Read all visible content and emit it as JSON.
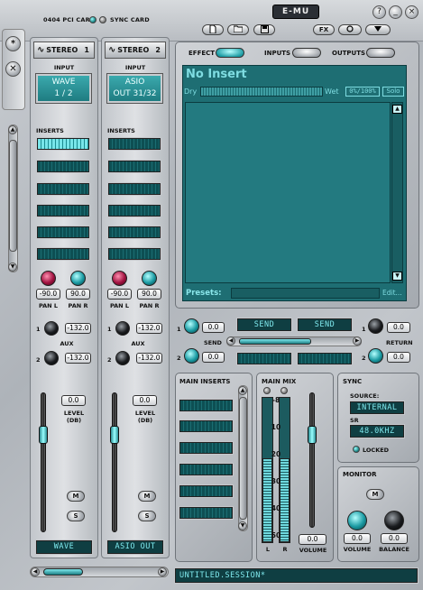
{
  "header": {
    "pci_card": "0404 PCI CARD",
    "sync_card": "SYNC CARD",
    "brand": "E-MU",
    "toolbar": [
      "new-doc",
      "open",
      "save"
    ],
    "fx_label": "FX",
    "win_buttons": [
      "?",
      "_",
      "×"
    ]
  },
  "sidenav": [
    "*",
    "✕"
  ],
  "strips": [
    {
      "name": "STEREO",
      "number": "1",
      "input_label": "INPUT",
      "input_line1": "WAVE",
      "input_line2": "1 / 2",
      "inserts_label": "INSERTS",
      "pan_l_val": "-90.0",
      "pan_r_val": "90.0",
      "pan_l_label": "PAN L",
      "pan_r_label": "PAN R",
      "aux_label": "AUX",
      "aux1_num": "1",
      "aux2_num": "2",
      "aux1_val": "-132.0",
      "aux2_val": "-132.0",
      "level_val": "0.0",
      "level_label": "LEVEL (DB)",
      "mute": "M",
      "solo": "S",
      "footer": "WAVE"
    },
    {
      "name": "STEREO",
      "number": "2",
      "input_label": "INPUT",
      "input_line1": "ASIO",
      "input_line2": "OUT 31/32",
      "inserts_label": "INSERTS",
      "pan_l_val": "-90.0",
      "pan_r_val": "90.0",
      "pan_l_label": "PAN L",
      "pan_r_label": "PAN R",
      "aux_label": "AUX",
      "aux1_num": "1",
      "aux2_num": "2",
      "aux1_val": "-132.0",
      "aux2_val": "-132.0",
      "level_val": "0.0",
      "level_label": "LEVEL (DB)",
      "mute": "M",
      "solo": "S",
      "footer": "ASIO OUT"
    }
  ],
  "effect_panel": {
    "effect_label": "EFFECT",
    "inputs_label": "INPUTS",
    "outputs_label": "OUTPUTS",
    "title": "No Insert",
    "dry_label": "Dry",
    "wet_label": "Wet",
    "mix_value": "0%/100%",
    "solo_label": "Solo",
    "presets_label": "Presets:",
    "edit_label": "Edit..."
  },
  "send_return": {
    "send1_val": "0.0",
    "send2_val": "0.0",
    "send_label": "SEND",
    "send_btn1": "SEND",
    "send_btn2": "SEND",
    "return_label": "RETURN",
    "return1_val": "0.0",
    "return2_val": "0.0",
    "n1": "1",
    "n2": "2"
  },
  "main_inserts": {
    "label": "MAIN INSERTS"
  },
  "main_mix": {
    "label": "MAIN MIX",
    "scale": [
      "-8",
      "10",
      "20",
      "30",
      "40",
      "50"
    ],
    "l": "L",
    "r": "R",
    "volume_val": "0.0",
    "volume_label": "VOLUME"
  },
  "sync": {
    "label": "SYNC",
    "source_label": "SOURCE:",
    "source_value": "INTERNAL",
    "sr_label": "SR",
    "sr_value": "48.0KHZ",
    "locked_label": "LOCKED"
  },
  "monitor": {
    "label": "MONITOR",
    "mute": "M",
    "volume_val": "0.0",
    "balance_val": "0.0",
    "volume_label": "VOLUME",
    "balance_label": "BALANCE"
  },
  "session": "UNTITLED.SESSION*",
  "meter_level": 0.58,
  "colors": {
    "lcd": "#1f7c81",
    "accent": "#6fd9de"
  }
}
